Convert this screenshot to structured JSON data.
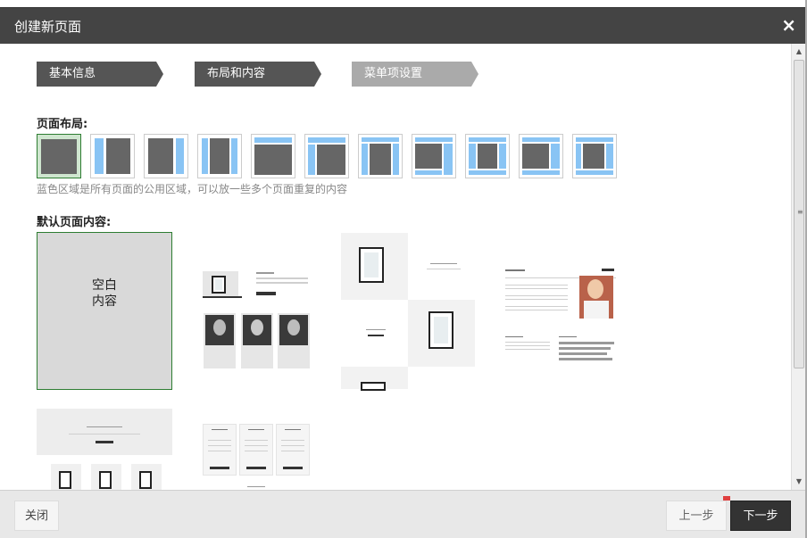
{
  "dialog": {
    "title": "创建新页面",
    "close_glyph": "×"
  },
  "steps": [
    {
      "label": "基本信息",
      "state": "done"
    },
    {
      "label": "布局和内容",
      "state": "current"
    },
    {
      "label": "菜单项设置",
      "state": "pending"
    }
  ],
  "layout_section": {
    "heading": "页面布局:",
    "hint": "蓝色区域是所有页面的公用区域，可以放一些多个页面重复的内容",
    "selected_index": 0,
    "option_count": 11
  },
  "content_section": {
    "heading": "默认页面内容:",
    "blank_template_label_line1": "空白",
    "blank_template_label_line2": "内容"
  },
  "footer": {
    "close_label": "关闭",
    "prev_label": "上一步",
    "next_label": "下一步"
  },
  "colors": {
    "titlebar": "#444444",
    "selected_border": "#2e7d32",
    "shared_area": "#89c4f4",
    "step_active": "#555555",
    "step_pending": "#aaaaaa"
  }
}
